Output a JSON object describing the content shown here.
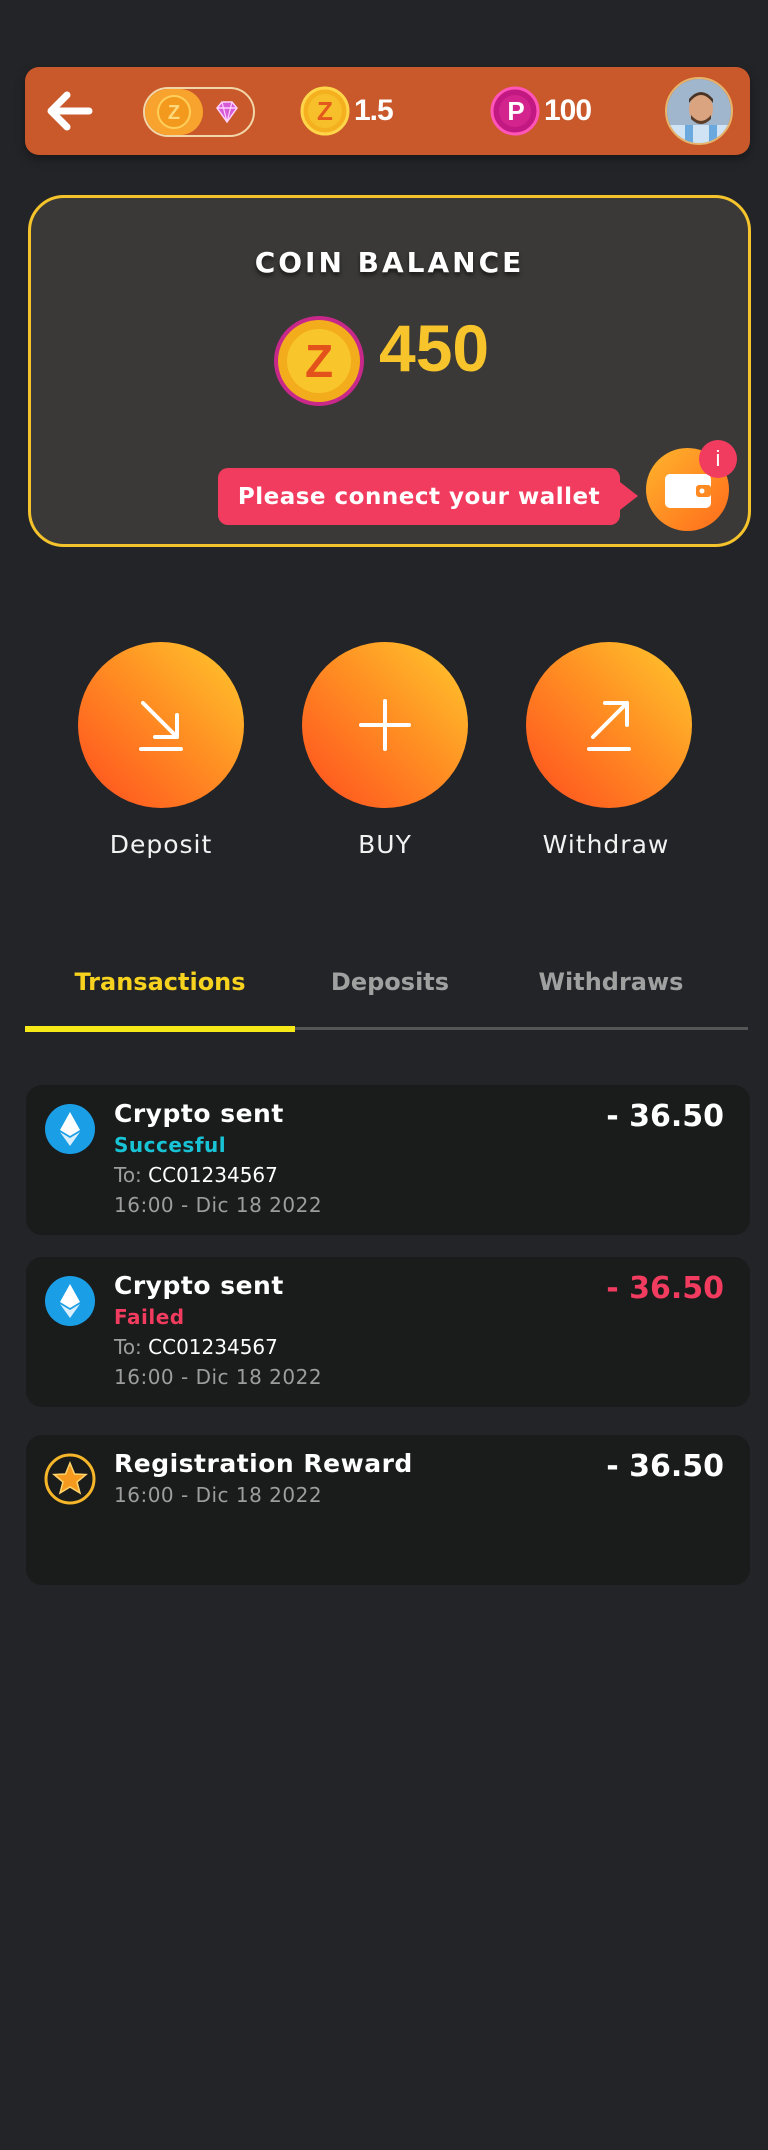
{
  "header": {
    "coin_balance": "1.5",
    "points_balance": "100",
    "icons": {
      "back": "arrow-left-icon",
      "coin": "z-coin-icon",
      "gem": "diamond-icon",
      "points": "p-coin-icon",
      "avatar": "user-avatar"
    }
  },
  "balance_card": {
    "title": "COIN BALANCE",
    "amount": "450",
    "connect_message": "Please connect your wallet",
    "info_badge": "i",
    "icons": {
      "coin": "z-coin-icon",
      "wallet": "wallet-icon"
    }
  },
  "actions": [
    {
      "label": "Deposit",
      "icon": "arrow-down-right-icon"
    },
    {
      "label": "BUY",
      "icon": "plus-icon"
    },
    {
      "label": "Withdraw",
      "icon": "arrow-up-right-icon"
    }
  ],
  "tabs": [
    {
      "label": "Transactions",
      "active": true
    },
    {
      "label": "Deposits",
      "active": false
    },
    {
      "label": "Withdraws",
      "active": false
    }
  ],
  "transactions": [
    {
      "title": "Crypto sent",
      "status": "Succesful",
      "to_label": "To:",
      "to": "CC01234567",
      "date": "16:00  -  Dic 18 2022",
      "amount": "- 36.50",
      "icon": "ethereum-icon"
    },
    {
      "title": "Crypto sent",
      "status": "Failed",
      "to_label": "To:",
      "to": "CC01234567",
      "date": "16:00  -  Dic 18 2022",
      "amount": "- 36.50",
      "icon": "ethereum-icon"
    },
    {
      "title": "Registration Reward",
      "date": "16:00  -  Dic 18 2022",
      "amount": "- 36.50",
      "icon": "star-icon"
    }
  ],
  "colors": {
    "background": "#222428",
    "header": "#c9582a",
    "card_border": "#f5c42c",
    "accent_yellow": "#f7c42c",
    "success": "#19c3d6",
    "failed": "#f23c5f",
    "action_gradient_start": "#ff4d1f",
    "action_gradient_end": "#ffc92d"
  }
}
